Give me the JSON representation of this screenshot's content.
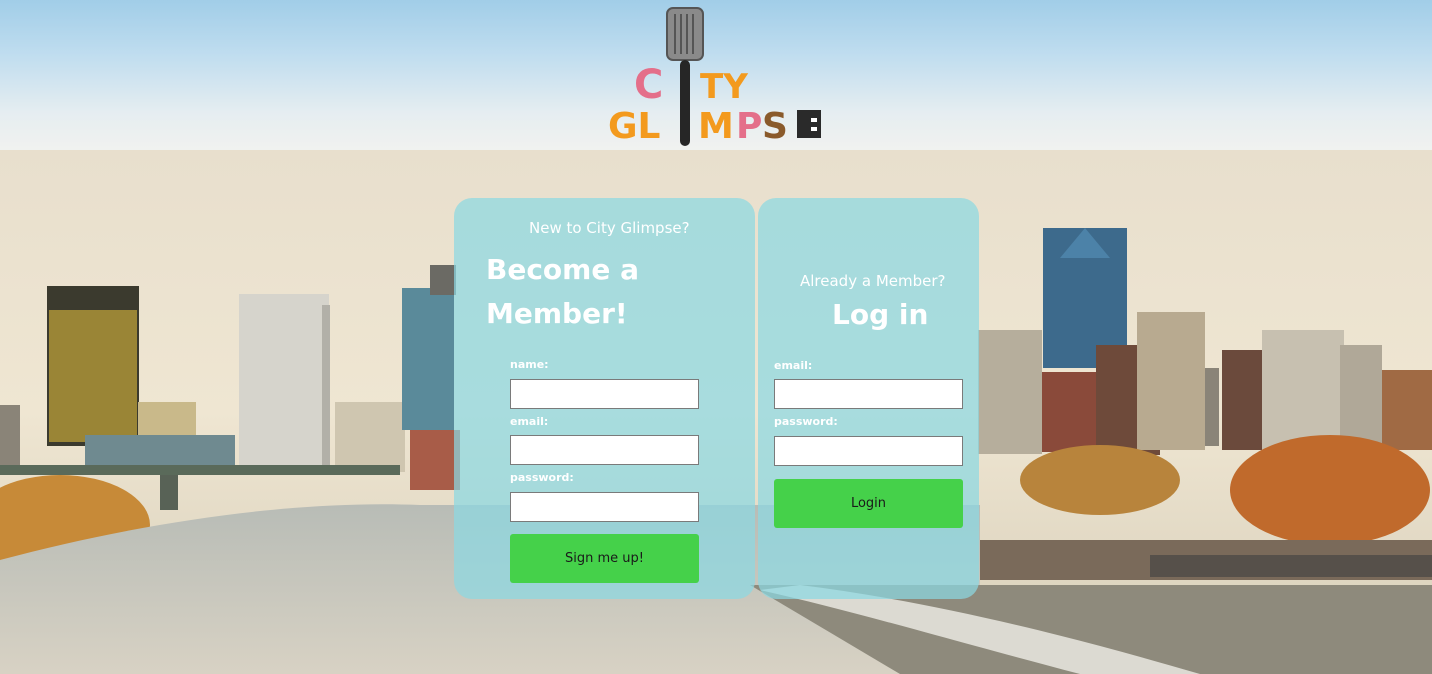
{
  "brand": {
    "logo_line1": "CITY",
    "logo_line2": "GLIMPSE",
    "colors": {
      "orange": "#f39a1e",
      "pink": "#e46f8a",
      "brown": "#8a5a2b",
      "dark": "#2a2a2a"
    }
  },
  "signup": {
    "eyebrow": "New to City Glimpse?",
    "headline_line1": "Become a",
    "headline_line2": "Member!",
    "name_label": "name:",
    "email_label": "email:",
    "password_label": "password:",
    "name_value": "",
    "email_value": "",
    "password_value": "",
    "submit_label": "Sign me up!"
  },
  "login": {
    "eyebrow": "Already a Member?",
    "headline": "Log in",
    "email_label": "email:",
    "password_label": "password:",
    "email_value": "",
    "password_value": "",
    "submit_label": "Login"
  },
  "theme": {
    "card_bg": "#8cd8e2",
    "button_bg": "#45d14a"
  }
}
